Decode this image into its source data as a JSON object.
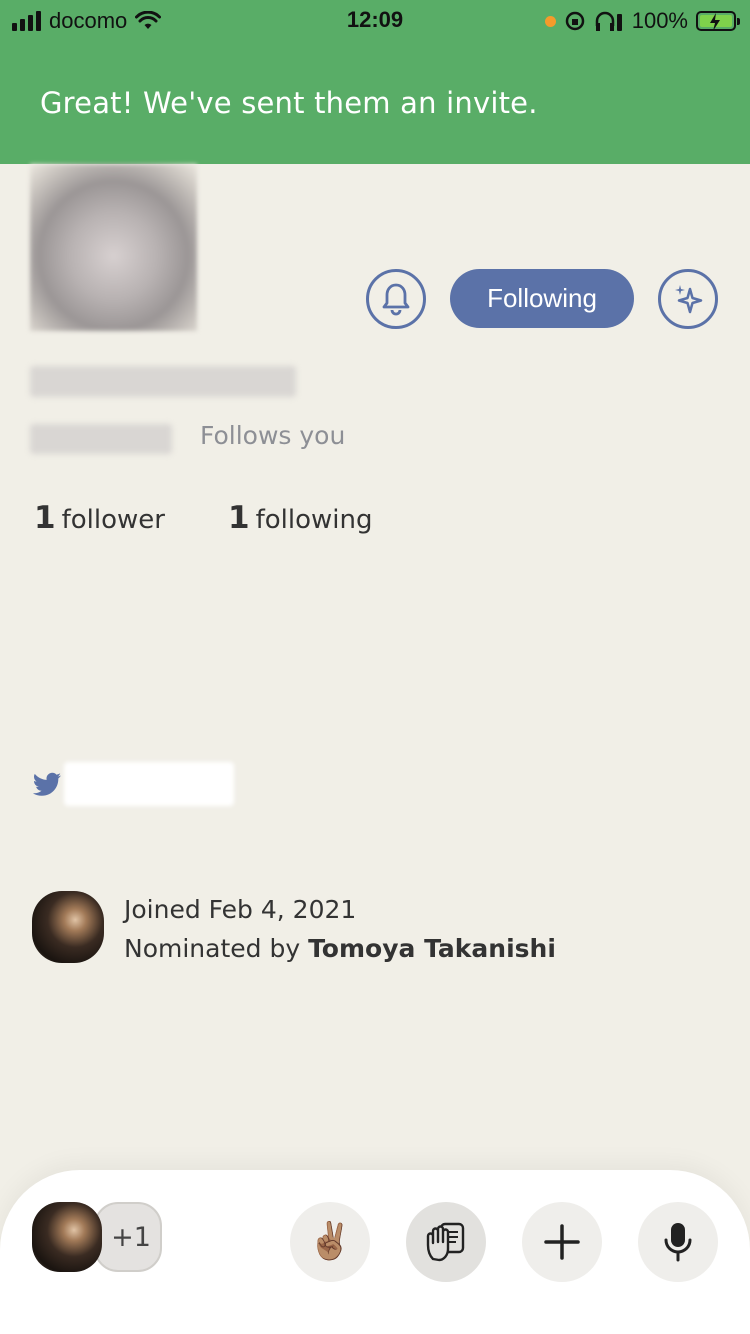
{
  "status_bar": {
    "carrier": "docomo",
    "time": "12:09",
    "battery": "100%"
  },
  "banner": {
    "message": "Great! We've sent them an invite."
  },
  "profile": {
    "follow_button": "Following",
    "follows_you": "Follows you",
    "followers": {
      "count": "1",
      "label": "follower"
    },
    "following": {
      "count": "1",
      "label": "following"
    }
  },
  "joined": {
    "date_text": "Joined Feb 4, 2021",
    "nominated_prefix": "Nominated by",
    "nominator": "Tomoya Takanishi"
  },
  "bottom_bar": {
    "extra_count": "+1",
    "raise_emoji": "✌🏽"
  },
  "icons": [
    "bell-icon",
    "sparkle-icon",
    "twitter-icon",
    "hand-raise-icon",
    "plus-icon",
    "microphone-icon",
    "wifi-icon",
    "signal-icon",
    "battery-icon"
  ],
  "colors": {
    "banner_green": "#59ad67",
    "accent_blue": "#5b72a8",
    "background": "#f1efe7",
    "twitter_blue": "#5b72a8"
  }
}
